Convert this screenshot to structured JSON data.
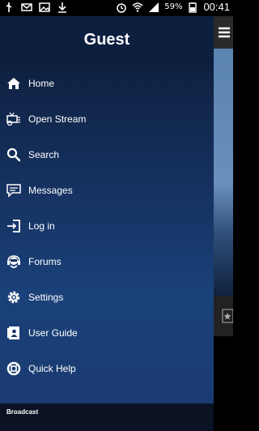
{
  "status_bar": {
    "battery": "59%",
    "time": "00:41",
    "icons_left": [
      "usb-icon",
      "mail-icon",
      "image-icon",
      "download-icon"
    ],
    "icons_right": [
      "alarm-icon",
      "wifi-icon",
      "signal-icon",
      "battery-icon"
    ]
  },
  "drawer": {
    "title": "Guest",
    "items": [
      {
        "label": "Home",
        "icon": "home-icon"
      },
      {
        "label": "Open Stream",
        "icon": "tv-stream-icon"
      },
      {
        "label": "Search",
        "icon": "search-icon"
      },
      {
        "label": "Messages",
        "icon": "messages-icon"
      },
      {
        "label": "Log in",
        "icon": "login-icon"
      },
      {
        "label": "Forums",
        "icon": "forums-icon"
      },
      {
        "label": "Settings",
        "icon": "settings-icon"
      },
      {
        "label": "User Guide",
        "icon": "user-guide-icon"
      },
      {
        "label": "Quick Help",
        "icon": "help-ring-icon"
      }
    ],
    "footer_label": "Broadcast"
  },
  "right_pane": {
    "menu_icon": "hamburger-icon"
  },
  "colors": {
    "drawer_top": "#0b1a33",
    "drawer_bottom": "#1a4179",
    "text": "#ffffff"
  }
}
